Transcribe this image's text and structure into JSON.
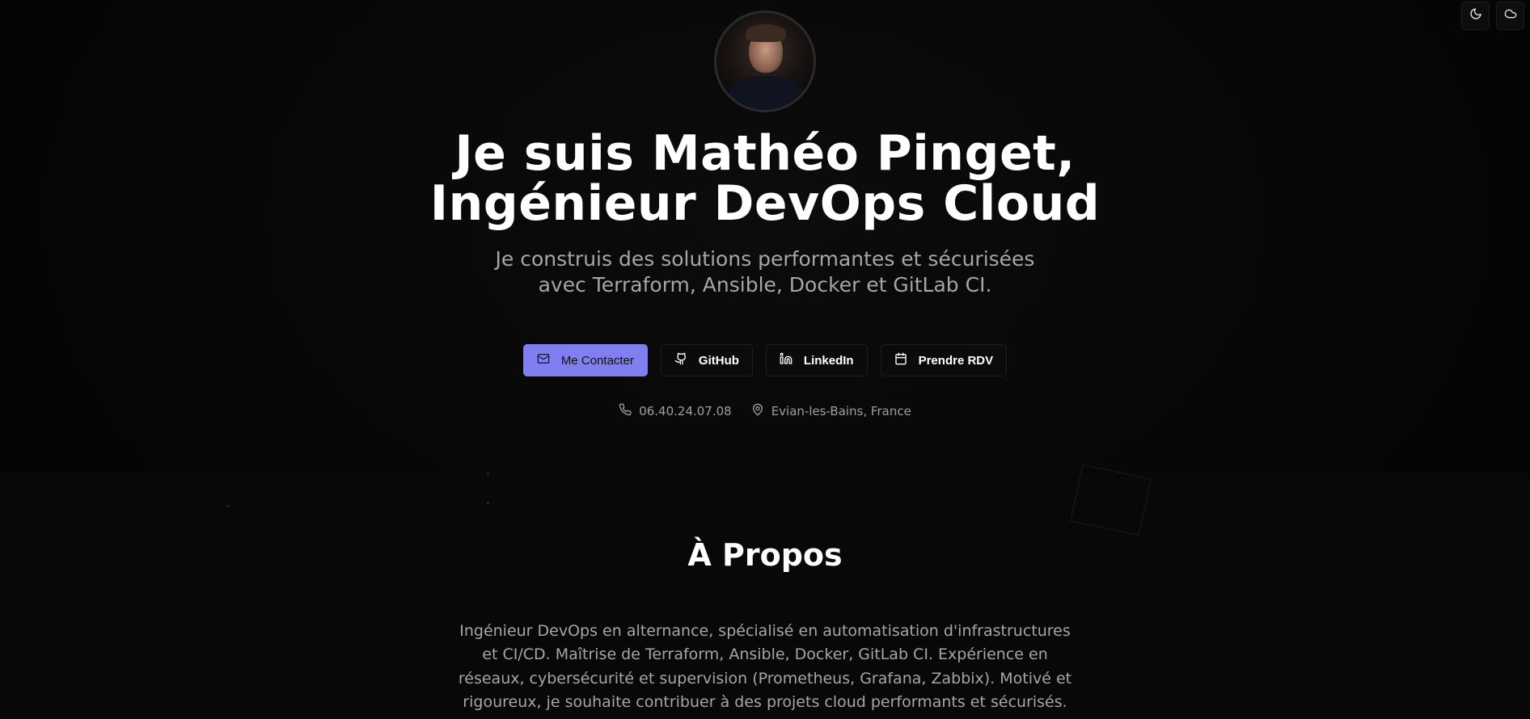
{
  "toggles": {
    "theme_icon": "moon-icon",
    "weather_icon": "cloud-icon"
  },
  "hero": {
    "headline_line1": "Je suis Mathéo Pinget,",
    "headline_line2": "Ingénieur DevOps Cloud",
    "subtitle": "Je construis des solutions performantes et sécurisées avec Terraform, Ansible, Docker et GitLab CI.",
    "buttons": [
      {
        "label": "Me Contacter",
        "icon": "mail-icon"
      },
      {
        "label": "GitHub",
        "icon": "github-icon"
      },
      {
        "label": "LinkedIn",
        "icon": "linkedin-icon"
      },
      {
        "label": "Prendre RDV",
        "icon": "calendar-icon"
      }
    ],
    "phone": "06.40.24.07.08",
    "location": "Evian-les-Bains, France"
  },
  "about": {
    "title": "À Propos",
    "text": "Ingénieur DevOps en alternance, spécialisé en automatisation d'infrastructures et CI/CD. Maîtrise de Terraform, Ansible, Docker, GitLab CI. Expérience en réseaux, cybersécurité et supervision (Prometheus, Grafana, Zabbix). Motivé et rigoureux, je souhaite contribuer à des projets cloud performants et sécurisés."
  },
  "colors": {
    "background": "#050505",
    "accent": "#7f7ff0",
    "muted_text": "#a6a6a6"
  }
}
